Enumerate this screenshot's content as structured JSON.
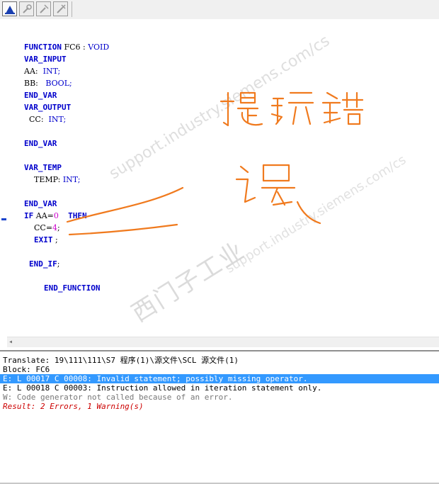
{
  "toolbar": {
    "buttons": [
      {
        "icon": "compile-icon",
        "active": true
      },
      {
        "icon": "tool-a-icon"
      },
      {
        "icon": "tool-b-icon"
      },
      {
        "icon": "tool-c-icon"
      }
    ]
  },
  "code": {
    "l1_kw": "FUNCTION",
    "l1_rest": " FC6 : ",
    "l1_type": "VOID",
    "l2": "VAR_INPUT",
    "l3_name": "AA:  ",
    "l3_type": "INT;",
    "l4_name": "BB:   ",
    "l4_type": "BOOL;",
    "l5": "END_VAR",
    "l6": "VAR_OUTPUT",
    "l7_name": "  CC:  ",
    "l7_type": "INT;",
    "l8": "END_VAR",
    "l9": "VAR_TEMP",
    "l10_name": "    TEMP: ",
    "l10_type": "INT;",
    "l11": "END_VAR",
    "l12_if": "IF",
    "l12_aa": " AA=",
    "l12_zero": "0",
    "l12_then": "  THEN",
    "l13_cc": "  CC=",
    "l13_num": "4",
    "l13_semi": ";",
    "l14_exit": "EXIT",
    "l14_semi": " ;",
    "l15_endif": "END_IF",
    "l15_semi": ";",
    "l16": "END_FUNCTION"
  },
  "watermark": {
    "site": "support.industry.siemens.com/cs",
    "cn": "西门子工业",
    "site2": "support.industry.siemens.com/cs"
  },
  "output": {
    "lines": [
      "Translate: 19\\111\\111\\S7 程序(1)\\源文件\\SCL 源文件(1)",
      "Block: FC6",
      "E: L 00017 C 00008: Invalid statement; possibly missing operator.",
      "E: L 00018 C 00003: Instruction allowed in iteration statement only.",
      "W: Code generator not called because of an error.",
      "Result: 2 Errors, 1 Warning(s)"
    ]
  },
  "colors": {
    "keyword": "#0000cc",
    "number": "#cc00cc",
    "selection": "#3399ff",
    "error_result": "#cc0000",
    "annotation": "#f07a1e"
  }
}
